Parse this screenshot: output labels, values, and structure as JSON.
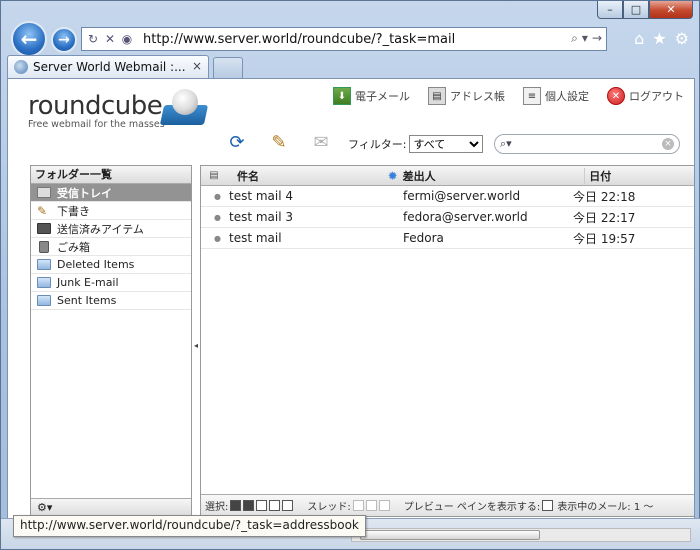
{
  "browser": {
    "url": "http://www.server.world/roundcube/?_task=mail",
    "tab_title": "Server World Webmail :...",
    "tab_close": "×",
    "status_url": "http://www.server.world/roundcube/?_task=addressbook"
  },
  "window": {
    "minimize": "–",
    "maximize": "□",
    "close": "✕"
  },
  "logo": {
    "word": "roundcube",
    "tagline": "Free webmail for the masses"
  },
  "top_nav": {
    "mail": "電子メール",
    "addressbook": "アドレス帳",
    "settings": "個人設定",
    "logout": "ログアウト"
  },
  "filter": {
    "label": "フィルター:",
    "selected": "すべて"
  },
  "search": {
    "placeholder": ""
  },
  "folders": {
    "header": "フォルダー一覧",
    "items": [
      {
        "label": "受信トレイ",
        "icon": "inbox-icon",
        "selected": true
      },
      {
        "label": "下書き",
        "icon": "pencil-icon"
      },
      {
        "label": "送信済みアイテム",
        "icon": "sent-icon"
      },
      {
        "label": "ごみ箱",
        "icon": "trash-icon"
      },
      {
        "label": "Deleted Items",
        "icon": "folder-icon"
      },
      {
        "label": "Junk E-mail",
        "icon": "folder-icon"
      },
      {
        "label": "Sent Items",
        "icon": "folder-icon"
      }
    ],
    "footer": "⚙▾"
  },
  "messages": {
    "columns": {
      "subject": "件名",
      "from": "差出人",
      "date": "日付"
    },
    "rows": [
      {
        "subject": "test mail 4",
        "from": "fermi@server.world",
        "date": "今日  22:18"
      },
      {
        "subject": "test mail 3",
        "from": "fedora@server.world",
        "date": "今日  22:17"
      },
      {
        "subject": "test mail",
        "from": "Fedora",
        "date": "今日  19:57"
      }
    ],
    "footer": {
      "select_label": "選択:",
      "thread_label": "スレッド:",
      "preview_label": "プレビュー ペインを表示する:",
      "count_label": "表示中のメール: 1 〜"
    }
  },
  "colors": {
    "selected_folder": "#939393",
    "accent": "#3a7fd9"
  }
}
